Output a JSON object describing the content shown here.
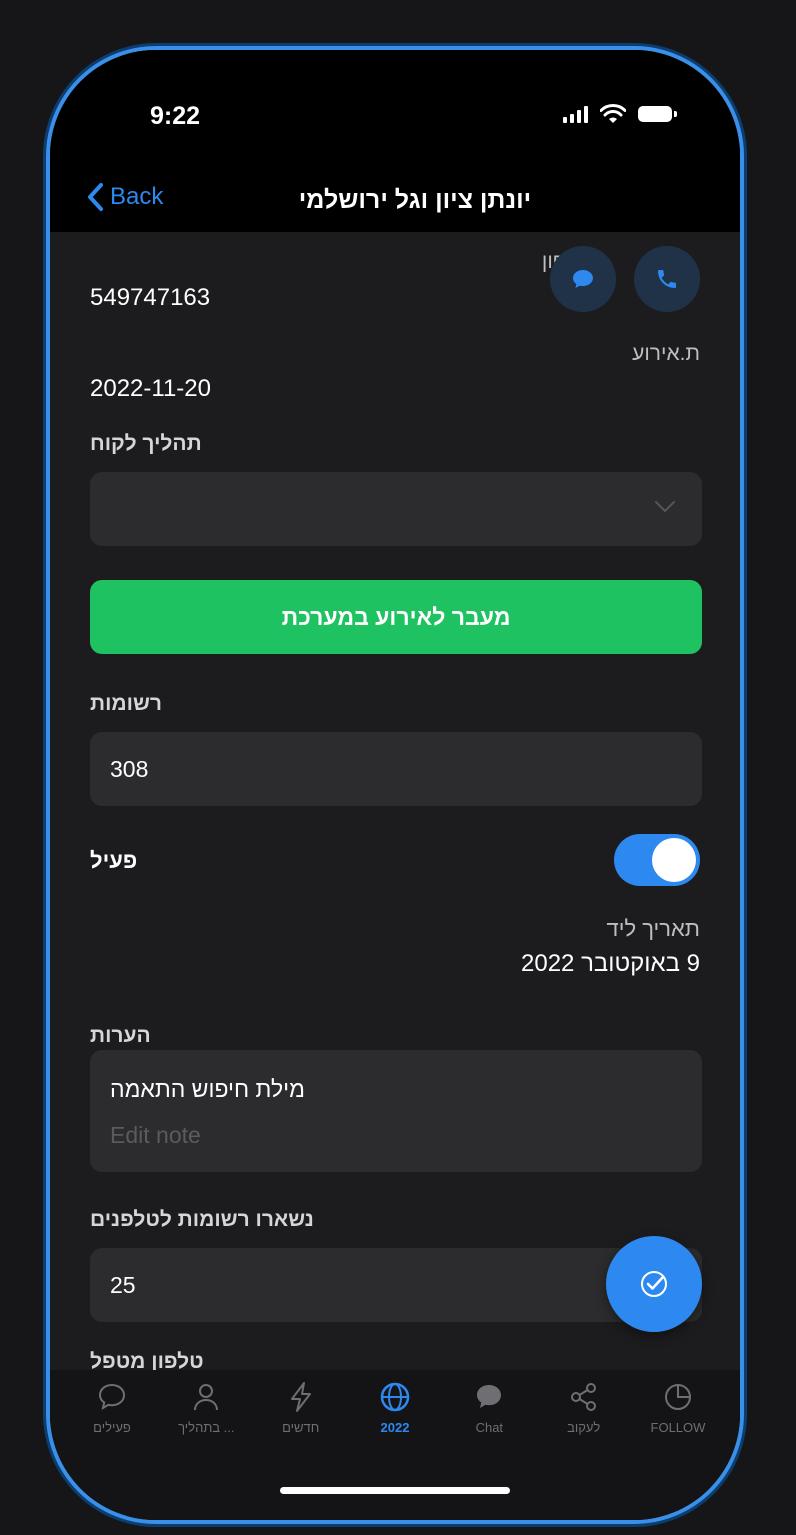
{
  "status_bar": {
    "time": "9:22"
  },
  "nav": {
    "back_label": "Back",
    "title": "יונתן ציון וגל ירושלמי"
  },
  "fields": {
    "phone_label": "טלפון",
    "phone_value": "549747163",
    "event_date_label": "ת.אירוע",
    "event_date_value": "2022-11-20",
    "customer_process_label": "תהליך לקוח",
    "customer_process_value": "",
    "goto_event_button": "מעבר לאירוע במערכת",
    "records_label": "רשומות",
    "records_value": "308",
    "active_label": "פעיל",
    "active_on": true,
    "lead_date_label": "תאריך ליד",
    "lead_date_value": "9 באוקטובר 2022",
    "notes_label": "הערות",
    "notes_value": "מילת חיפוש התאמה",
    "notes_placeholder": "Edit note",
    "remaining_label": "נשארו רשומות לטלפנים",
    "remaining_value": "25",
    "cut_off_label": "טלפון מטפל"
  },
  "tabs": [
    {
      "label": "פעילים",
      "icon": "chat-bubble-icon",
      "active": false
    },
    {
      "label": "... בתהליך",
      "icon": "person-icon",
      "active": false
    },
    {
      "label": "חדשים",
      "icon": "lightning-icon",
      "active": false
    },
    {
      "label": "2022",
      "icon": "globe-icon",
      "active": true
    },
    {
      "label": "Chat",
      "icon": "chat-filled-icon",
      "active": false
    },
    {
      "label": "לעקוב",
      "icon": "share-icon",
      "active": false
    },
    {
      "label": "FOLLOW",
      "icon": "pie-clock-icon",
      "active": false
    }
  ],
  "colors": {
    "accent": "#2d89f0",
    "green": "#1fc261",
    "background": "#1c1c1e",
    "field": "#2c2c2f"
  }
}
